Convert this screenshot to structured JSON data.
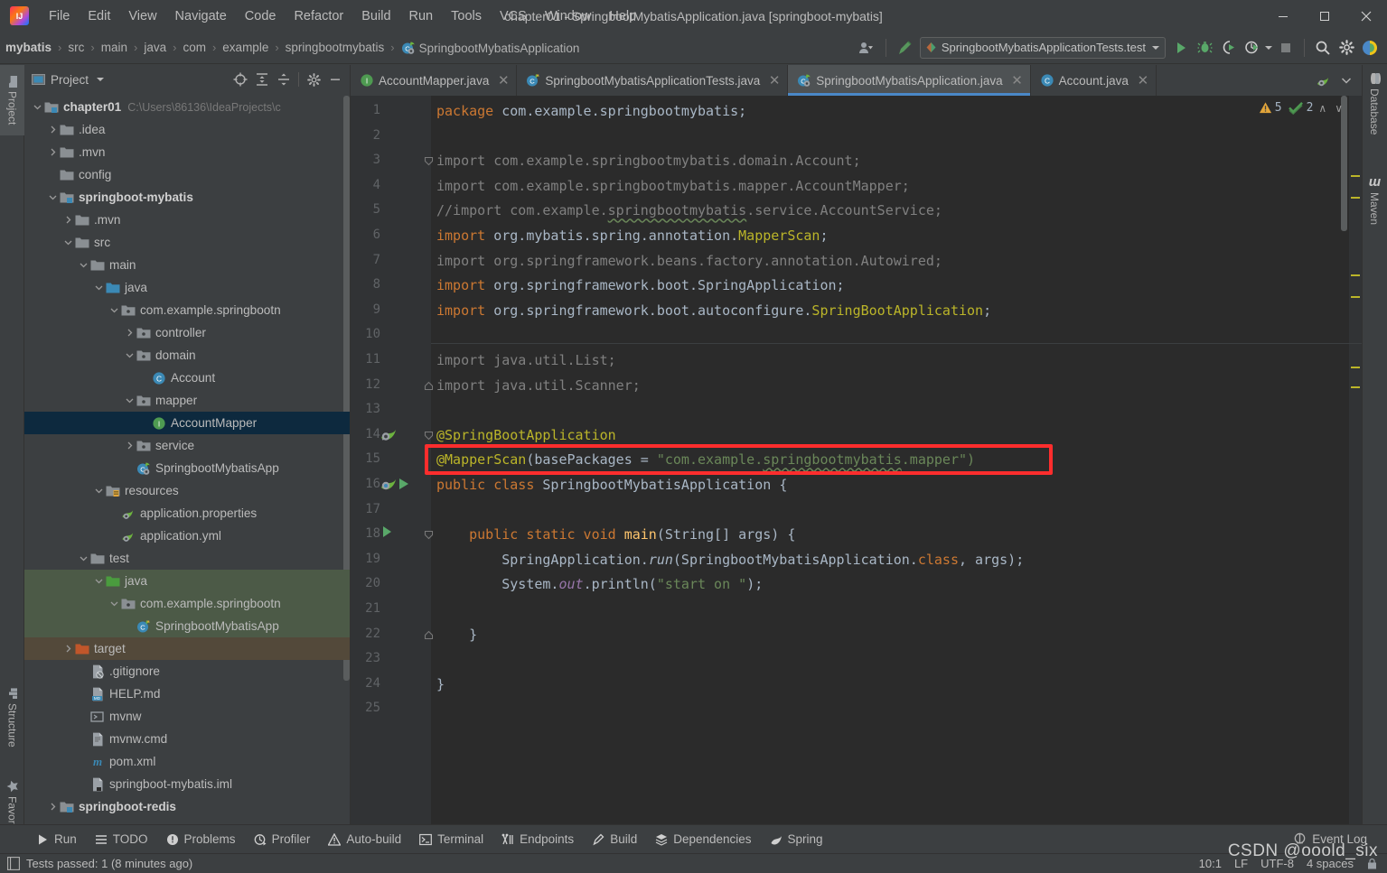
{
  "window": {
    "title": "chapter01 - SpringbootMybatisApplication.java [springboot-mybatis]",
    "minimize": "─",
    "maximize": "☐",
    "close": "✕"
  },
  "menu": [
    {
      "label": "File"
    },
    {
      "label": "Edit"
    },
    {
      "label": "View"
    },
    {
      "label": "Navigate"
    },
    {
      "label": "Code"
    },
    {
      "label": "Refactor"
    },
    {
      "label": "Build"
    },
    {
      "label": "Run"
    },
    {
      "label": "Tools"
    },
    {
      "label": "VCS"
    },
    {
      "label": "Window"
    },
    {
      "label": "Help"
    }
  ],
  "navbar": {
    "crumbs": [
      {
        "label": "mybatis",
        "bold": true
      },
      {
        "label": "src"
      },
      {
        "label": "main"
      },
      {
        "label": "java"
      },
      {
        "label": "com"
      },
      {
        "label": "example"
      },
      {
        "label": "springbootmybatis"
      },
      {
        "label": "SpringbootMybatisApplication",
        "icon": "spring-class-icon"
      }
    ],
    "separator": "›",
    "run_config": "SpringbootMybatisApplicationTests.test",
    "icons": [
      "user-profile-icon",
      "build-hammer-icon",
      "run-icon",
      "debug-icon",
      "run-with-coverage-icon",
      "profiler-icon",
      "stop-icon",
      "search-everywhere-icon",
      "settings-gear-icon",
      "ide-assistant-icon"
    ]
  },
  "left_stripe": [
    {
      "label": "Project",
      "active": true,
      "icon": "project-folder-icon"
    },
    {
      "label": "Structure",
      "active": false,
      "icon": "structure-icon"
    },
    {
      "label": "Favorites",
      "active": false,
      "icon": "star-icon"
    }
  ],
  "right_stripe": [
    {
      "label": "Database",
      "icon": "database-icon"
    },
    {
      "label": "Maven",
      "icon": "maven-m-icon"
    }
  ],
  "project_panel": {
    "title": "Project",
    "header_icons": [
      "select-opened-file-icon",
      "expand-all-icon",
      "collapse-all-icon",
      "settings-gear-icon",
      "hide-icon"
    ],
    "tree": [
      {
        "depth": 0,
        "arrow": "down",
        "icon": "module-icon",
        "label": "chapter01",
        "bold": true,
        "path": "C:\\Users\\86136\\IdeaProjects\\c"
      },
      {
        "depth": 1,
        "arrow": "right",
        "icon": "folder-icon",
        "label": ".idea"
      },
      {
        "depth": 1,
        "arrow": "right",
        "icon": "folder-icon",
        "label": ".mvn"
      },
      {
        "depth": 1,
        "arrow": "none",
        "icon": "folder-icon",
        "label": "config"
      },
      {
        "depth": 1,
        "arrow": "down",
        "icon": "module-icon",
        "label": "springboot-mybatis",
        "bold": true
      },
      {
        "depth": 2,
        "arrow": "right",
        "icon": "folder-icon",
        "label": ".mvn"
      },
      {
        "depth": 2,
        "arrow": "down",
        "icon": "folder-icon",
        "label": "src"
      },
      {
        "depth": 3,
        "arrow": "down",
        "icon": "folder-icon",
        "label": "main"
      },
      {
        "depth": 4,
        "arrow": "down",
        "icon": "source-root-icon",
        "label": "java"
      },
      {
        "depth": 5,
        "arrow": "down",
        "icon": "package-icon",
        "label": "com.example.springbootn"
      },
      {
        "depth": 6,
        "arrow": "right",
        "icon": "package-icon",
        "label": "controller"
      },
      {
        "depth": 6,
        "arrow": "down",
        "icon": "package-icon",
        "label": "domain"
      },
      {
        "depth": 7,
        "arrow": "none",
        "icon": "class-icon",
        "label": "Account"
      },
      {
        "depth": 6,
        "arrow": "down",
        "icon": "package-icon",
        "label": "mapper"
      },
      {
        "depth": 7,
        "arrow": "none",
        "icon": "interface-icon",
        "label": "AccountMapper",
        "selected": true
      },
      {
        "depth": 6,
        "arrow": "right",
        "icon": "package-icon",
        "label": "service"
      },
      {
        "depth": 6,
        "arrow": "none",
        "icon": "spring-class-icon",
        "label": "SpringbootMybatisApp"
      },
      {
        "depth": 4,
        "arrow": "down",
        "icon": "resource-root-icon",
        "label": "resources"
      },
      {
        "depth": 5,
        "arrow": "none",
        "icon": "spring-file-icon",
        "label": "application.properties"
      },
      {
        "depth": 5,
        "arrow": "none",
        "icon": "spring-file-icon",
        "label": "application.yml"
      },
      {
        "depth": 3,
        "arrow": "down",
        "icon": "folder-icon",
        "label": "test"
      },
      {
        "depth": 4,
        "arrow": "down",
        "icon": "test-root-icon",
        "label": "java",
        "greenbg": true
      },
      {
        "depth": 5,
        "arrow": "down",
        "icon": "package-icon",
        "label": "com.example.springbootn",
        "greenbg": true
      },
      {
        "depth": 6,
        "arrow": "none",
        "icon": "spring-test-icon",
        "label": "SpringbootMybatisApp",
        "greenbg": true
      },
      {
        "depth": 2,
        "arrow": "right",
        "icon": "target-folder-icon",
        "label": "target",
        "brownbg": true
      },
      {
        "depth": 3,
        "arrow": "none",
        "icon": "gitignore-icon",
        "label": ".gitignore"
      },
      {
        "depth": 3,
        "arrow": "none",
        "icon": "md-icon",
        "label": "HELP.md"
      },
      {
        "depth": 3,
        "arrow": "none",
        "icon": "shell-icon",
        "label": "mvnw"
      },
      {
        "depth": 3,
        "arrow": "none",
        "icon": "cmd-icon",
        "label": "mvnw.cmd"
      },
      {
        "depth": 3,
        "arrow": "none",
        "icon": "maven-m-icon",
        "label": "pom.xml"
      },
      {
        "depth": 3,
        "arrow": "none",
        "icon": "iml-icon",
        "label": "springboot-mybatis.iml"
      },
      {
        "depth": 1,
        "arrow": "right",
        "icon": "module-icon",
        "label": "springboot-redis",
        "bold": true
      }
    ]
  },
  "editor": {
    "tabs": [
      {
        "label": "AccountMapper.java",
        "icon": "interface-icon",
        "active": false,
        "close": "✕"
      },
      {
        "label": "SpringbootMybatisApplicationTests.java",
        "icon": "spring-test-icon",
        "active": false,
        "close": "✕"
      },
      {
        "label": "SpringbootMybatisApplication.java",
        "icon": "spring-class-icon",
        "active": true,
        "close": "✕"
      },
      {
        "label": "Account.java",
        "icon": "class-icon",
        "active": false,
        "close": "✕"
      }
    ],
    "tabbar_extra_icons": [
      "spring-file-icon",
      "chevron-down-icon"
    ],
    "inspections": {
      "warnings": "5",
      "checks": "2",
      "up": "∧",
      "down": "∨"
    },
    "caret_position": "10:1",
    "line_separator": "LF",
    "encoding": "UTF-8",
    "indent": "4 spaces",
    "lines": [
      {
        "num": 1,
        "tokens": [
          {
            "t": "package ",
            "c": "k"
          },
          {
            "t": "com.example.springbootmybatis;",
            "c": "n"
          }
        ]
      },
      {
        "num": 2,
        "tokens": []
      },
      {
        "num": 3,
        "tokens": [
          {
            "t": "import ",
            "c": "cm"
          },
          {
            "t": "com.example.springbootmybatis.domain.Account;",
            "c": "cm"
          }
        ],
        "fold": "start"
      },
      {
        "num": 4,
        "tokens": [
          {
            "t": "import ",
            "c": "cm"
          },
          {
            "t": "com.example.springbootmybatis.mapper.AccountMapper;",
            "c": "cm"
          }
        ]
      },
      {
        "num": 5,
        "tokens": [
          {
            "t": "//import com.example.",
            "c": "cm"
          },
          {
            "t": "springbootmybatis",
            "c": "cm squiggle"
          },
          {
            "t": ".service.AccountService;",
            "c": "cm"
          }
        ]
      },
      {
        "num": 6,
        "tokens": [
          {
            "t": "import ",
            "c": "k"
          },
          {
            "t": "org.mybatis.spring.annotation.",
            "c": "n"
          },
          {
            "t": "MapperScan",
            "c": "an"
          },
          {
            "t": ";",
            "c": "n"
          }
        ]
      },
      {
        "num": 7,
        "tokens": [
          {
            "t": "import org.springframework.beans.factory.annotation.Autowired;",
            "c": "cm"
          }
        ]
      },
      {
        "num": 8,
        "tokens": [
          {
            "t": "import ",
            "c": "k"
          },
          {
            "t": "org.springframework.boot.SpringApplication;",
            "c": "n"
          }
        ]
      },
      {
        "num": 9,
        "tokens": [
          {
            "t": "import ",
            "c": "k"
          },
          {
            "t": "org.springframework.boot.autoconfigure.",
            "c": "n"
          },
          {
            "t": "SpringBootApplication",
            "c": "an"
          },
          {
            "t": ";",
            "c": "n"
          }
        ]
      },
      {
        "num": 10,
        "tokens": []
      },
      {
        "num": 11,
        "tokens": [
          {
            "t": "import java.util.List;",
            "c": "cm"
          }
        ]
      },
      {
        "num": 12,
        "tokens": [
          {
            "t": "import java.util.Scanner;",
            "c": "cm"
          }
        ],
        "fold": "end"
      },
      {
        "num": 13,
        "tokens": []
      },
      {
        "num": 14,
        "tokens": [
          {
            "t": "@SpringBootApplication",
            "c": "an"
          }
        ],
        "fold": "start",
        "gutter_icon": "spring-bean-icon"
      },
      {
        "num": 15,
        "tokens": [
          {
            "t": "@MapperScan",
            "c": "an"
          },
          {
            "t": "(basePackages = ",
            "c": "n"
          },
          {
            "t": "\"com.example.",
            "c": "s"
          },
          {
            "t": "springbootmybatis",
            "c": "s squiggle"
          },
          {
            "t": ".mapper\")",
            "c": "s"
          }
        ],
        "highlight": true
      },
      {
        "num": 16,
        "tokens": [
          {
            "t": "public class ",
            "c": "k"
          },
          {
            "t": "SpringbootMybatisApplication ",
            "c": "n"
          },
          {
            "t": "{",
            "c": "n"
          }
        ],
        "gutter_icon": "spring-run-icon"
      },
      {
        "num": 17,
        "tokens": []
      },
      {
        "num": 18,
        "tokens": [
          {
            "t": "    public static void ",
            "c": "k"
          },
          {
            "t": "main",
            "c": "fn"
          },
          {
            "t": "(String[] args) {",
            "c": "n"
          }
        ],
        "fold": "start",
        "gutter_icon": "run-green-icon"
      },
      {
        "num": 19,
        "tokens": [
          {
            "t": "        SpringApplication.",
            "c": "n"
          },
          {
            "t": "run",
            "c": "mi"
          },
          {
            "t": "(SpringbootMybatisApplication.",
            "c": "n"
          },
          {
            "t": "class",
            "c": "k"
          },
          {
            "t": ", args);",
            "c": "n"
          }
        ]
      },
      {
        "num": 20,
        "tokens": [
          {
            "t": "        System.",
            "c": "n"
          },
          {
            "t": "out",
            "c": "im"
          },
          {
            "t": ".println(",
            "c": "n"
          },
          {
            "t": "\"start on \"",
            "c": "s"
          },
          {
            "t": ");",
            "c": "n"
          }
        ]
      },
      {
        "num": 21,
        "tokens": []
      },
      {
        "num": 22,
        "tokens": [
          {
            "t": "    }",
            "c": "n"
          }
        ],
        "fold": "end"
      },
      {
        "num": 23,
        "tokens": []
      },
      {
        "num": 24,
        "tokens": [
          {
            "t": "}",
            "c": "n"
          }
        ]
      },
      {
        "num": 25,
        "tokens": []
      }
    ]
  },
  "bottom_toolwindows": [
    {
      "label": "Run",
      "icon": "run-icon"
    },
    {
      "label": "TODO",
      "icon": "todo-list-icon"
    },
    {
      "label": "Problems",
      "icon": "problems-icon"
    },
    {
      "label": "Profiler",
      "icon": "profiler-icon"
    },
    {
      "label": "Auto-build",
      "icon": "warning-triangle-icon"
    },
    {
      "label": "Terminal",
      "icon": "terminal-icon"
    },
    {
      "label": "Endpoints",
      "icon": "endpoints-icon"
    },
    {
      "label": "Build",
      "icon": "build-hammer-icon"
    },
    {
      "label": "Dependencies",
      "icon": "dependencies-icon"
    },
    {
      "label": "Spring",
      "icon": "spring-leaf-icon"
    }
  ],
  "event_log": {
    "label": "Event Log",
    "icon": "event-log-icon"
  },
  "statusbar": {
    "message": "Tests passed: 1 (8 minutes ago)",
    "icon": "tests-passed-icon"
  },
  "watermark": {
    "text": "CSDN @ooold_six"
  },
  "colors": {
    "accent": "#4a88c7",
    "keyword": "#cc7832",
    "annotation": "#bbb529",
    "string": "#6a8759",
    "comment": "#808080",
    "selection": "#0d293e",
    "highlight_box": "#ff2d2d",
    "editor_bg": "#2b2b2b",
    "panel_bg": "#3c3f41"
  }
}
